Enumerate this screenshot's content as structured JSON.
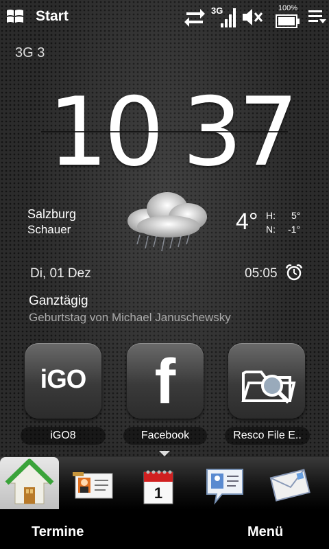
{
  "statusbar": {
    "title": "Start",
    "network_type": "3G",
    "battery_percent": "100%",
    "icons": [
      "windows-logo",
      "data-transfer-icon",
      "signal-3g-icon",
      "volume-muted-icon",
      "battery-icon",
      "menu-icon"
    ]
  },
  "network_label": "3G 3",
  "clock": {
    "hours": "10",
    "minutes": "37"
  },
  "weather": {
    "city": "Salzburg",
    "condition": "Schauer",
    "temperature": "4°",
    "high_label": "H:",
    "high_value": "5°",
    "low_label": "N:",
    "low_value": "-1°",
    "icon": "rain-cloud-icon"
  },
  "date": "Di, 01 Dez",
  "alarm": {
    "time": "05:05",
    "icon": "alarm-clock-icon"
  },
  "event": {
    "title": "Ganztägig",
    "description": "Geburtstag von Michael Januschewsky"
  },
  "apps": [
    {
      "label": "iGO8",
      "icon_text": "iGO"
    },
    {
      "label": "Facebook",
      "icon_text": "f"
    },
    {
      "label": "Resco File E..",
      "icon": "folder-search-icon"
    }
  ],
  "tabs": [
    "home-icon",
    "contacts-icon",
    "calendar-icon",
    "messages-icon",
    "mail-icon"
  ],
  "calendar_day": "1",
  "softkeys": {
    "left": "Termine",
    "right": "Menü"
  },
  "colors": {
    "background": "#2b2b2b",
    "tabbar_active": "#d8d8d8",
    "home_green": "#3aa33a",
    "calendar_red": "#d02020"
  }
}
